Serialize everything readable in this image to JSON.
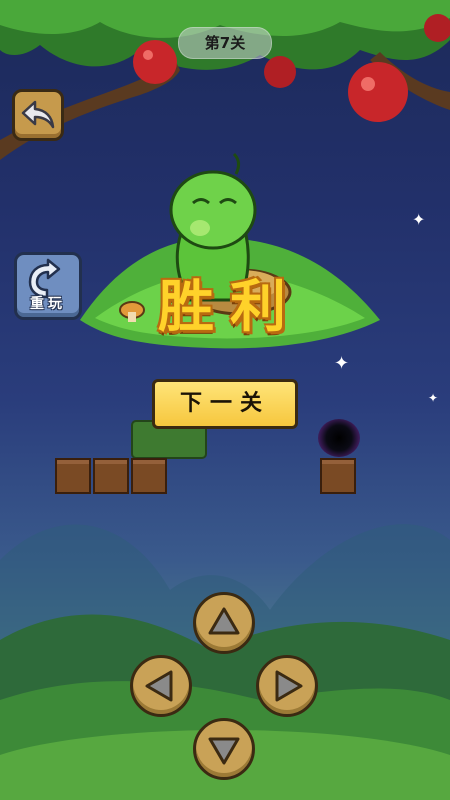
{
  "header": {
    "level_label": "第7关"
  },
  "controls": {
    "back_icon": "back-arrow-icon",
    "restart_icon": "restart-arrow-icon",
    "restart_label": "重玩"
  },
  "result": {
    "title": "胜利",
    "next_button_label": "下一关"
  },
  "dpad": {
    "up": "up-arrow-icon",
    "left": "left-arrow-icon",
    "right": "right-arrow-icon",
    "down": "down-arrow-icon"
  },
  "colors": {
    "accent_gold": "#ffd22a",
    "button_yellow": "#f6c73e",
    "block_brown": "#7a4a24",
    "worm_green": "#5cc43a"
  }
}
